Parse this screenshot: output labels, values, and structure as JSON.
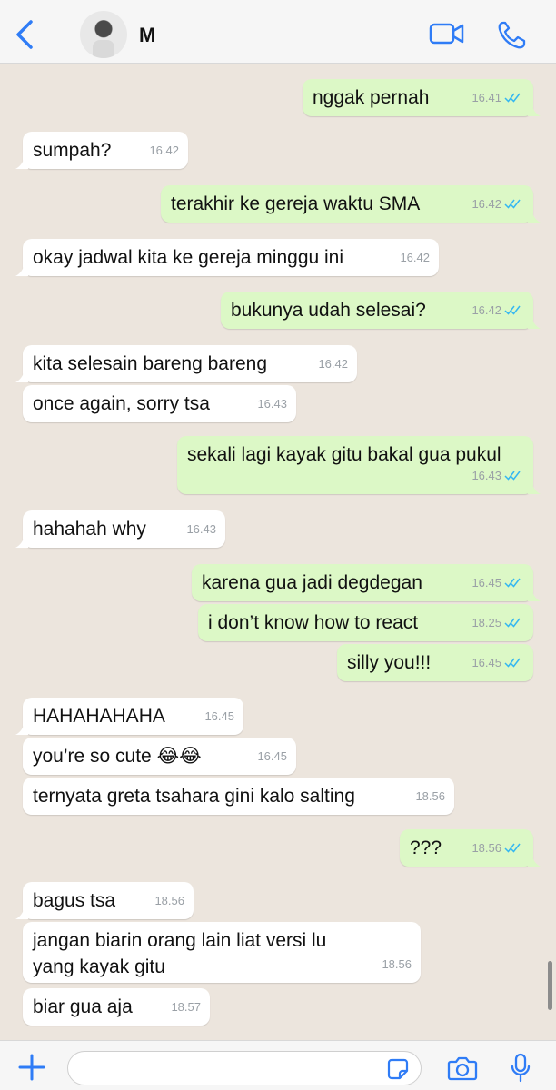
{
  "header": {
    "contact_name": "M",
    "accent": "#2F7CF6"
  },
  "colors": {
    "incoming": "#FFFFFF",
    "outgoing": "#DCF8C6",
    "chat_bg": "#ECE5DD",
    "read_ticks": "#34B7F1"
  },
  "messages": [
    {
      "dir": "out",
      "text": "nggak pernah",
      "time": "16.41"
    },
    {
      "dir": "in",
      "text": "sumpah?",
      "time": "16.42"
    },
    {
      "dir": "out",
      "text": "terakhir ke gereja waktu SMA",
      "time": "16.42"
    },
    {
      "dir": "in",
      "text": "okay jadwal kita ke gereja minggu ini",
      "time": "16.42"
    },
    {
      "dir": "out",
      "text": "bukunya udah selesai?",
      "time": "16.42"
    },
    {
      "dir": "in",
      "text": "kita selesain bareng bareng",
      "time": "16.42"
    },
    {
      "dir": "in",
      "text": "once again, sorry tsa",
      "time": "16.43"
    },
    {
      "dir": "out",
      "text": "sekali lagi kayak gitu bakal gua pukul",
      "time": "16.43"
    },
    {
      "dir": "in",
      "text": "hahahah why",
      "time": "16.43"
    },
    {
      "dir": "out",
      "text": "karena gua jadi degdegan",
      "time": "16.45"
    },
    {
      "dir": "out",
      "text": "i don’t know how to react",
      "time": "18.25"
    },
    {
      "dir": "out",
      "text": "silly you!!!",
      "time": "16.45"
    },
    {
      "dir": "in",
      "text": "HAHAHAHAHA",
      "time": "16.45"
    },
    {
      "dir": "in",
      "text": "you’re so cute 😂😂",
      "time": "16.45"
    },
    {
      "dir": "in",
      "text": "ternyata greta tsahara gini kalo salting",
      "time": "18.56"
    },
    {
      "dir": "out",
      "text": "???",
      "time": "18.56"
    },
    {
      "dir": "in",
      "text": "bagus tsa",
      "time": "18.56"
    },
    {
      "dir": "in",
      "text": "jangan biarin orang lain liat versi lu\nyang kayak gitu",
      "time": "18.56"
    },
    {
      "dir": "in",
      "text": "biar gua aja",
      "time": "18.57"
    }
  ],
  "composer": {
    "placeholder": ""
  }
}
